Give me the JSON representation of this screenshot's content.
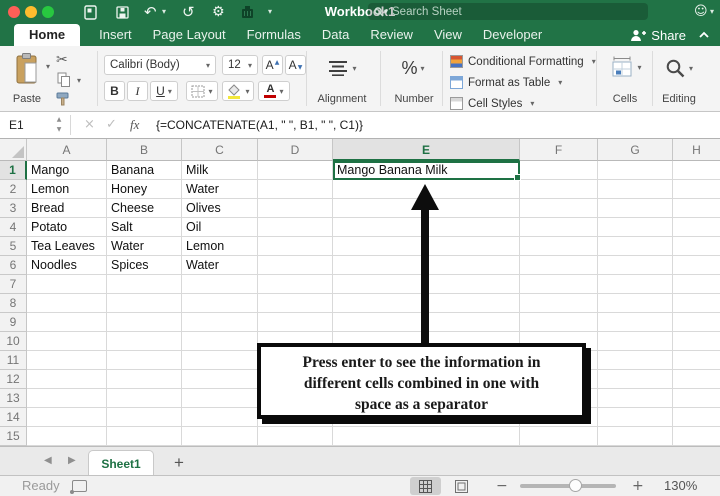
{
  "titlebar": {
    "title": "Workbook1",
    "search_placeholder": "Search Sheet"
  },
  "ribbon_tabs": [
    {
      "label": "Home",
      "active": true
    },
    {
      "label": "Insert",
      "active": false
    },
    {
      "label": "Page Layout",
      "active": false
    },
    {
      "label": "Formulas",
      "active": false
    },
    {
      "label": "Data",
      "active": false
    },
    {
      "label": "Review",
      "active": false
    },
    {
      "label": "View",
      "active": false
    },
    {
      "label": "Developer",
      "active": false
    }
  ],
  "share": {
    "label": "Share"
  },
  "ribbon": {
    "paste_label": "Paste",
    "font_name": "Calibri (Body)",
    "font_size": "12",
    "bold_label": "B",
    "italic_label": "I",
    "underline_label": "U",
    "font_color_glyph": "A",
    "grow_font_glyph": "A",
    "shrink_font_glyph": "A",
    "alignment_label": "Alignment",
    "number_glyph": "%",
    "number_label": "Number",
    "style_buttons": [
      "Conditional Formatting",
      "Format as Table",
      "Cell Styles"
    ],
    "cells_label": "Cells",
    "editing_label": "Editing"
  },
  "formula_bar": {
    "name_box": "E1",
    "fx_label": "fx",
    "formula": "{=CONCATENATE(A1, \" \", B1, \" \", C1)}"
  },
  "grid": {
    "columns": [
      "A",
      "B",
      "C",
      "D",
      "E",
      "F",
      "G",
      "H"
    ],
    "row_count": 15,
    "selected_cell": {
      "ref": "E1",
      "column": "E",
      "row": 1,
      "value": "Mango Banana Milk"
    },
    "rows": [
      {
        "n": 1,
        "cells": [
          "Mango",
          "Banana",
          "Milk",
          "",
          "Mango Banana Milk",
          "",
          "",
          ""
        ]
      },
      {
        "n": 2,
        "cells": [
          "Lemon",
          "Honey",
          "Water",
          "",
          "",
          "",
          "",
          ""
        ]
      },
      {
        "n": 3,
        "cells": [
          "Bread",
          "Cheese",
          "Olives",
          "",
          "",
          "",
          "",
          ""
        ]
      },
      {
        "n": 4,
        "cells": [
          "Potato",
          "Salt",
          "Oil",
          "",
          "",
          "",
          "",
          ""
        ]
      },
      {
        "n": 5,
        "cells": [
          "Tea Leaves",
          "Water",
          "Lemon",
          "",
          "",
          "",
          "",
          ""
        ]
      },
      {
        "n": 6,
        "cells": [
          "Noodles",
          "Spices",
          "Water",
          "",
          "",
          "",
          "",
          ""
        ]
      }
    ]
  },
  "annotation": {
    "lines": [
      "Press enter to see the information in",
      "different cells combined in one with",
      "space as a separator"
    ]
  },
  "sheet_bar": {
    "active_tab": "Sheet1",
    "add_label": "+"
  },
  "status_bar": {
    "ready_label": "Ready",
    "zoom_level": "130%"
  },
  "colors": {
    "excel_green": "#217346",
    "selection_green": "#1e7144",
    "ribbon_bg": "#f4f4f4",
    "fill_swatch": "#f3e73a",
    "font_color_swatch": "#c00000",
    "traffic_red": "#ff5f57",
    "traffic_yellow": "#febc2e",
    "traffic_green": "#28c840",
    "annotation_border": "#000000"
  },
  "icons": {
    "undo-icon": "↶",
    "redo-icon": "↺",
    "settings-icon": "⚙",
    "more-commands-icon": "▾",
    "caret": "▾",
    "feedback-smiley-icon": "☺",
    "cut-icon": "✂",
    "stepper-up": "▲",
    "stepper-down": "▼",
    "cancel-icon": "×",
    "enter-icon": "✓",
    "prev-sheet-icon": "◀",
    "next-sheet-icon": "▶",
    "zoom-out-icon": "−",
    "zoom-in-icon": "+",
    "new-workbook-icon": "svg-page",
    "save-icon": "svg-floppy",
    "print-icon": "svg-printer",
    "search-icon": "svg-magnifier",
    "share-person-icon": "svg-person-plus",
    "collapse-ribbon-icon": "svg-chevron-up",
    "paste-clipboard-icon": "svg-clipboard",
    "copy-icon": "svg-two-pages",
    "format-painter-icon": "svg-brush",
    "borders-icon": "svg-border-grid",
    "fill-color-icon": "svg-bucket",
    "alignment-icon": "svg-lines",
    "conditional-formatting-icon": "css-bars",
    "format-as-table-icon": "css-table",
    "cell-styles-icon": "css-table",
    "cells-icon": "svg-cells-grid",
    "editing-search-icon": "svg-magnifier",
    "macro-record-icon": "css-rect-dot",
    "normal-view-icon": "svg-grid",
    "page-layout-view-icon": "svg-page",
    "select-all-icon": "css-triangle",
    "fill-handle": "css-square",
    "up-arrow-annotation": "css-arrow"
  }
}
